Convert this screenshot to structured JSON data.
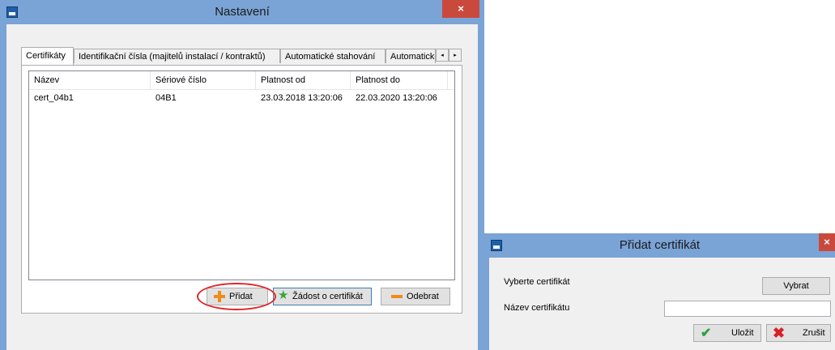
{
  "settings_window": {
    "title": "Nastavení",
    "close_label": "×",
    "tabs": [
      {
        "label": "Certifikáty",
        "active": true
      },
      {
        "label": "Identifikační čísla (majitelů instalací / kontraktů)",
        "active": false
      },
      {
        "label": "Automatické stahování",
        "active": false
      },
      {
        "label": "Automaticko",
        "active": false
      }
    ],
    "tab_scroll": {
      "left": "◂",
      "right": "▸"
    },
    "table": {
      "columns": [
        "Název",
        "Sériové číslo",
        "Platnost od",
        "Platnost do"
      ],
      "rows": [
        [
          "cert_04b1",
          "04B1",
          "23.03.2018 13:20:06",
          "22.03.2020 13:20:06"
        ]
      ]
    },
    "buttons": {
      "add": "Přidat",
      "request": "Žádost o certifikát",
      "remove": "Odebrat"
    }
  },
  "add_cert_window": {
    "title": "Přidat certifikát",
    "close_label": "×",
    "select_label": "Vyberte certifikát",
    "select_button": "Vybrat",
    "name_label": "Název certifikátu",
    "name_value": "",
    "save_button": "Uložit",
    "cancel_button": "Zrušit"
  },
  "colors": {
    "titlebar": "#7aa3d6",
    "close": "#c94a3c",
    "highlight_ellipse": "#e0262b",
    "accent_orange": "#f08b1d",
    "accent_green": "#34a53a"
  },
  "icons": [
    "app-icon",
    "plus-icon",
    "star-icon",
    "minus-icon",
    "checkmark-icon",
    "x-mark-icon"
  ]
}
